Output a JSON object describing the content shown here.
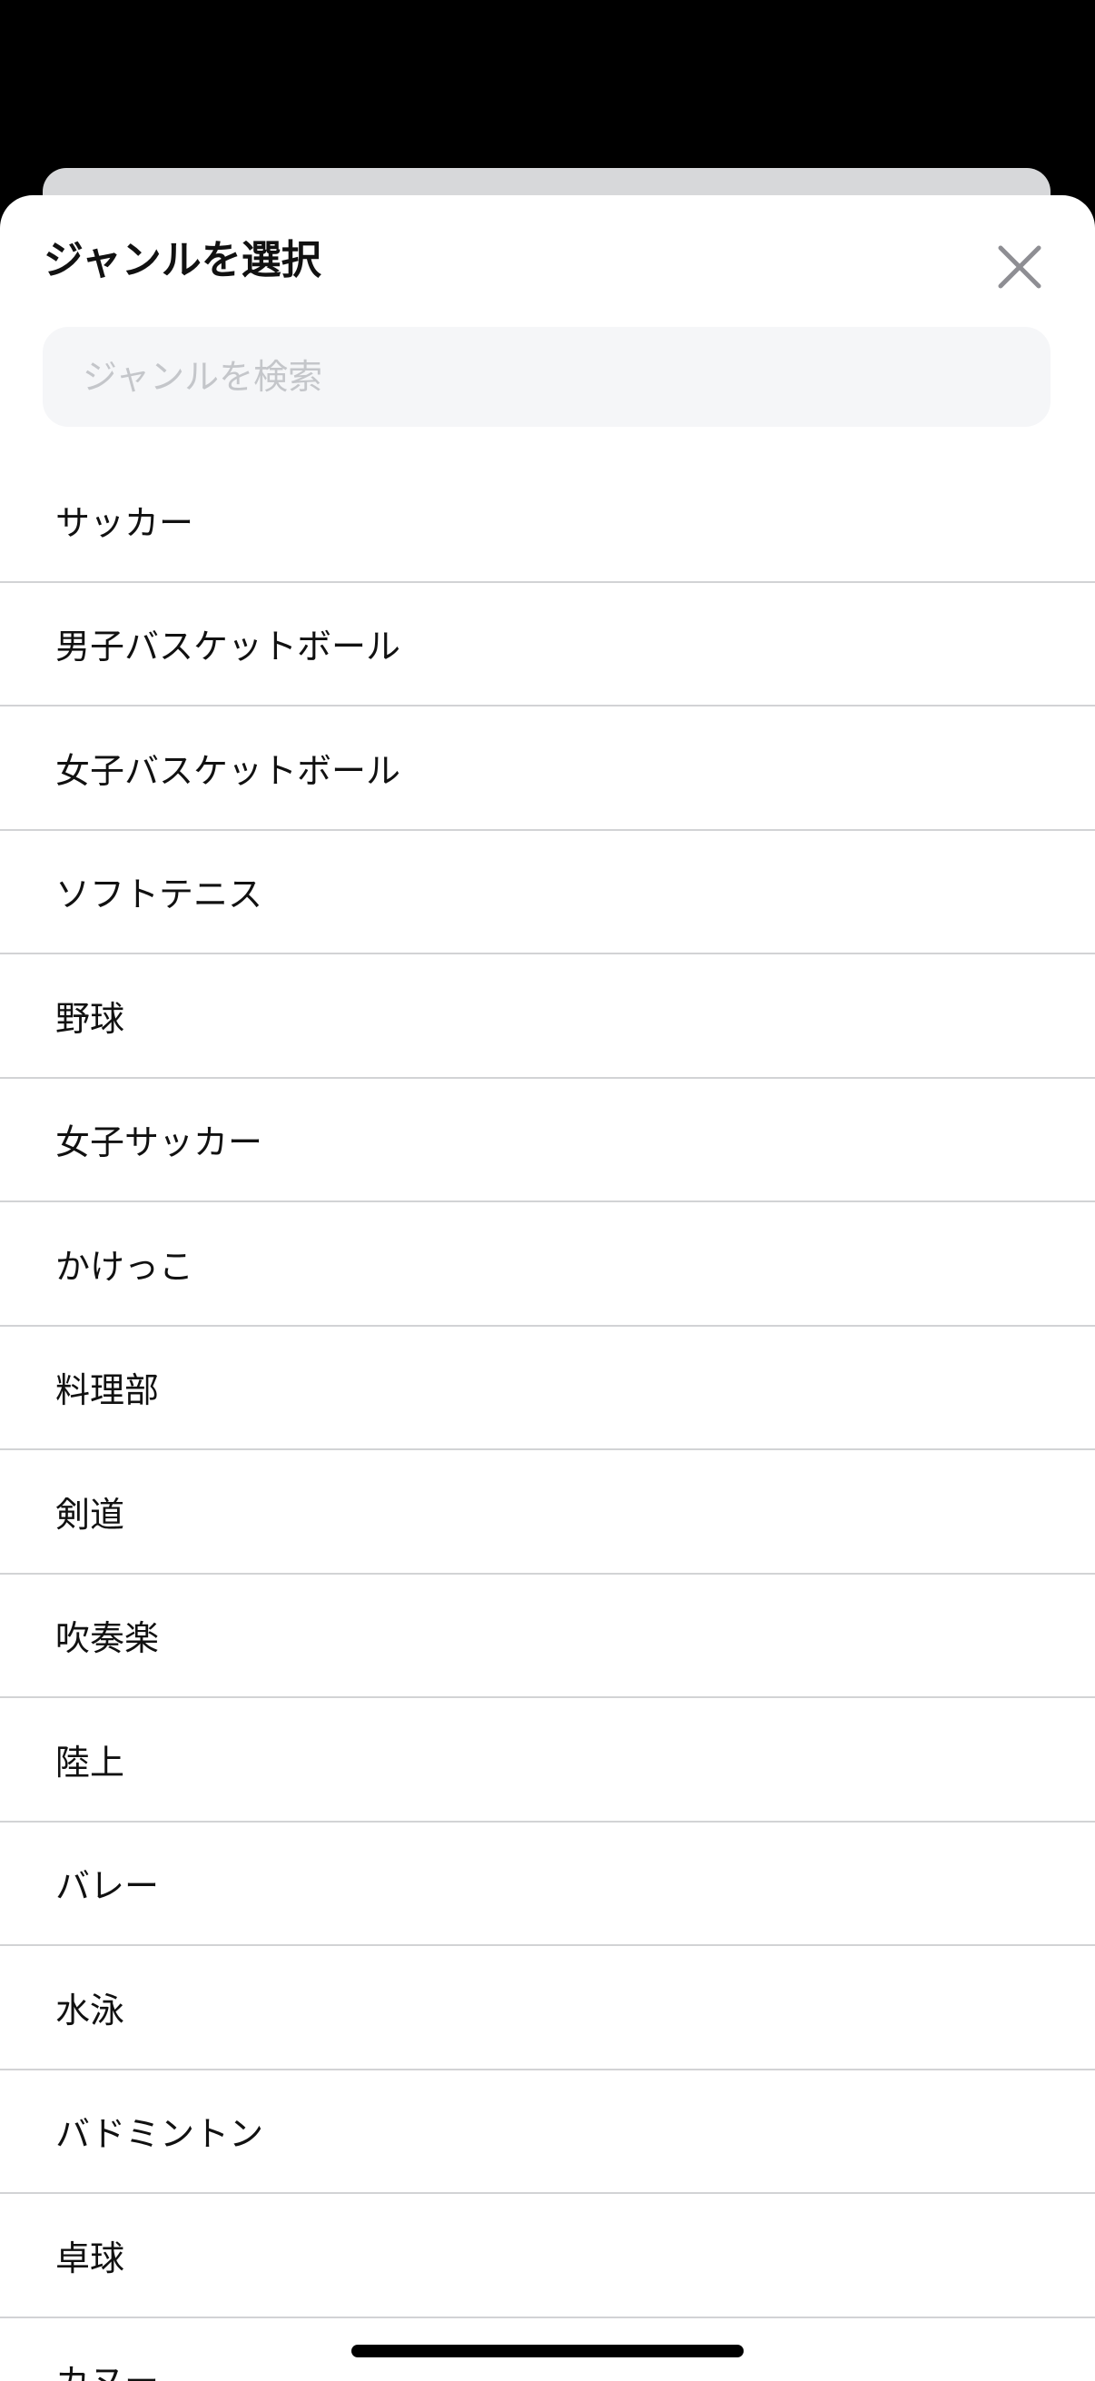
{
  "sheet": {
    "title": "ジャンルを選択",
    "close_icon": "close-icon"
  },
  "search": {
    "placeholder": "ジャンルを検索",
    "value": ""
  },
  "genres": [
    "サッカー",
    "男子バスケットボール",
    "女子バスケットボール",
    "ソフトテニス",
    "野球",
    "女子サッカー",
    "かけっこ",
    "料理部",
    "剣道",
    "吹奏楽",
    "陸上",
    "バレー",
    "水泳",
    "バドミントン",
    "卓球",
    "カヌー"
  ],
  "colors": {
    "background": "#000000",
    "sheet": "#ffffff",
    "search_bg": "#f5f6f8",
    "divider": "#d2d3d5",
    "close_icon": "#8e8e93"
  }
}
